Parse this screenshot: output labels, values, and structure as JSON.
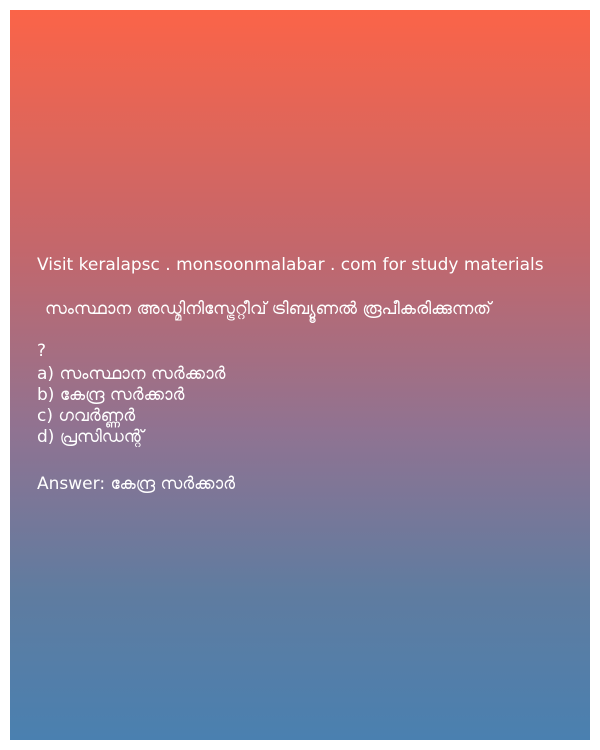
{
  "promo_text": "Visit keralapsc . monsoonmalabar . com for study materials",
  "question_text": "സംസ്ഥാന അഡ്മിനിസ്ട്രേറ്റീവ് ട്രിബ്യൂണൽ രൂപീകരിക്കുന്നത്",
  "question_mark": "?",
  "options": [
    "a) സംസ്ഥാന സർക്കാർ",
    "b) കേന്ദ്ര സർക്കാർ",
    "c) ഗവർണ്ണർ",
    "d) പ്രസിഡന്റ്"
  ],
  "answer_text": "Answer: കേന്ദ്ര സർക്കാർ",
  "colors": {
    "gradient_top": "#fb6448",
    "gradient_bottom": "#4a80b0",
    "text": "#ffffff"
  }
}
